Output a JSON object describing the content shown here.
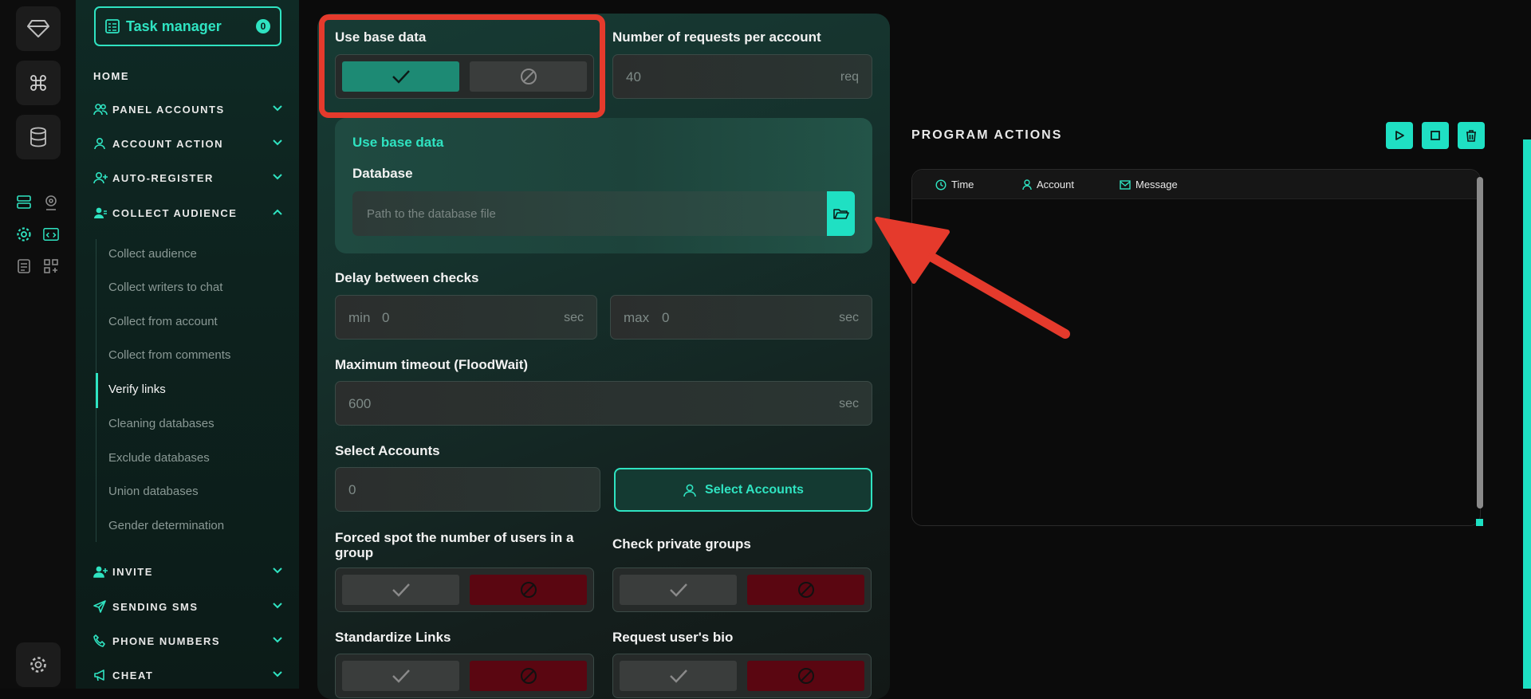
{
  "rail": {
    "icons": [
      "diamond-icon",
      "command-icon",
      "database-icon",
      "server-list-icon",
      "webcam-icon",
      "settings-cog-icon",
      "code-window-icon",
      "document-list-icon",
      "apps-icon",
      "gear-icon"
    ]
  },
  "sidebar": {
    "task_manager": {
      "label": "Task manager",
      "count": "0"
    },
    "home": "HOME",
    "sections": [
      {
        "label": "PANEL ACCOUNTS"
      },
      {
        "label": "ACCOUNT ACTION"
      },
      {
        "label": "AUTO-REGISTER"
      },
      {
        "label": "COLLECT AUDIENCE"
      },
      {
        "label": "INVITE"
      },
      {
        "label": "SENDING SMS"
      },
      {
        "label": "PHONE NUMBERS"
      },
      {
        "label": "CHEAT"
      }
    ],
    "sub_items": [
      "Collect audience",
      "Collect writers to chat",
      "Collect from account",
      "Collect from comments",
      "Verify links",
      "Cleaning databases",
      "Exclude databases",
      "Union databases",
      "Gender determination"
    ]
  },
  "form": {
    "use_base_data": "Use base data",
    "requests_label": "Number of requests per account",
    "requests_value": "40",
    "requests_unit": "req",
    "inner_title": "Use base data",
    "database_label": "Database",
    "database_placeholder": "Path to the database file",
    "delay_label": "Delay between checks",
    "delay_min_prefix": "min",
    "delay_min": "0",
    "delay_max_prefix": "max",
    "delay_max": "0",
    "sec": "sec",
    "timeout_label": "Maximum timeout (FloodWait)",
    "timeout_value": "600",
    "select_accounts_label": "Select Accounts",
    "select_accounts_count": "0",
    "select_accounts_button": "Select Accounts",
    "forced_spot_label": "Forced spot the number of users in a group",
    "check_private_label": "Check private groups",
    "standardize_label": "Standardize Links",
    "request_bio_label": "Request user's bio"
  },
  "program_actions": {
    "title": "PROGRAM ACTIONS",
    "columns": [
      "Time",
      "Account",
      "Message"
    ]
  },
  "colors": {
    "accent": "#2fe3c1",
    "annotation": "#e53a2c",
    "off_active": "#5a0611",
    "on_active": "#1d8a74"
  }
}
